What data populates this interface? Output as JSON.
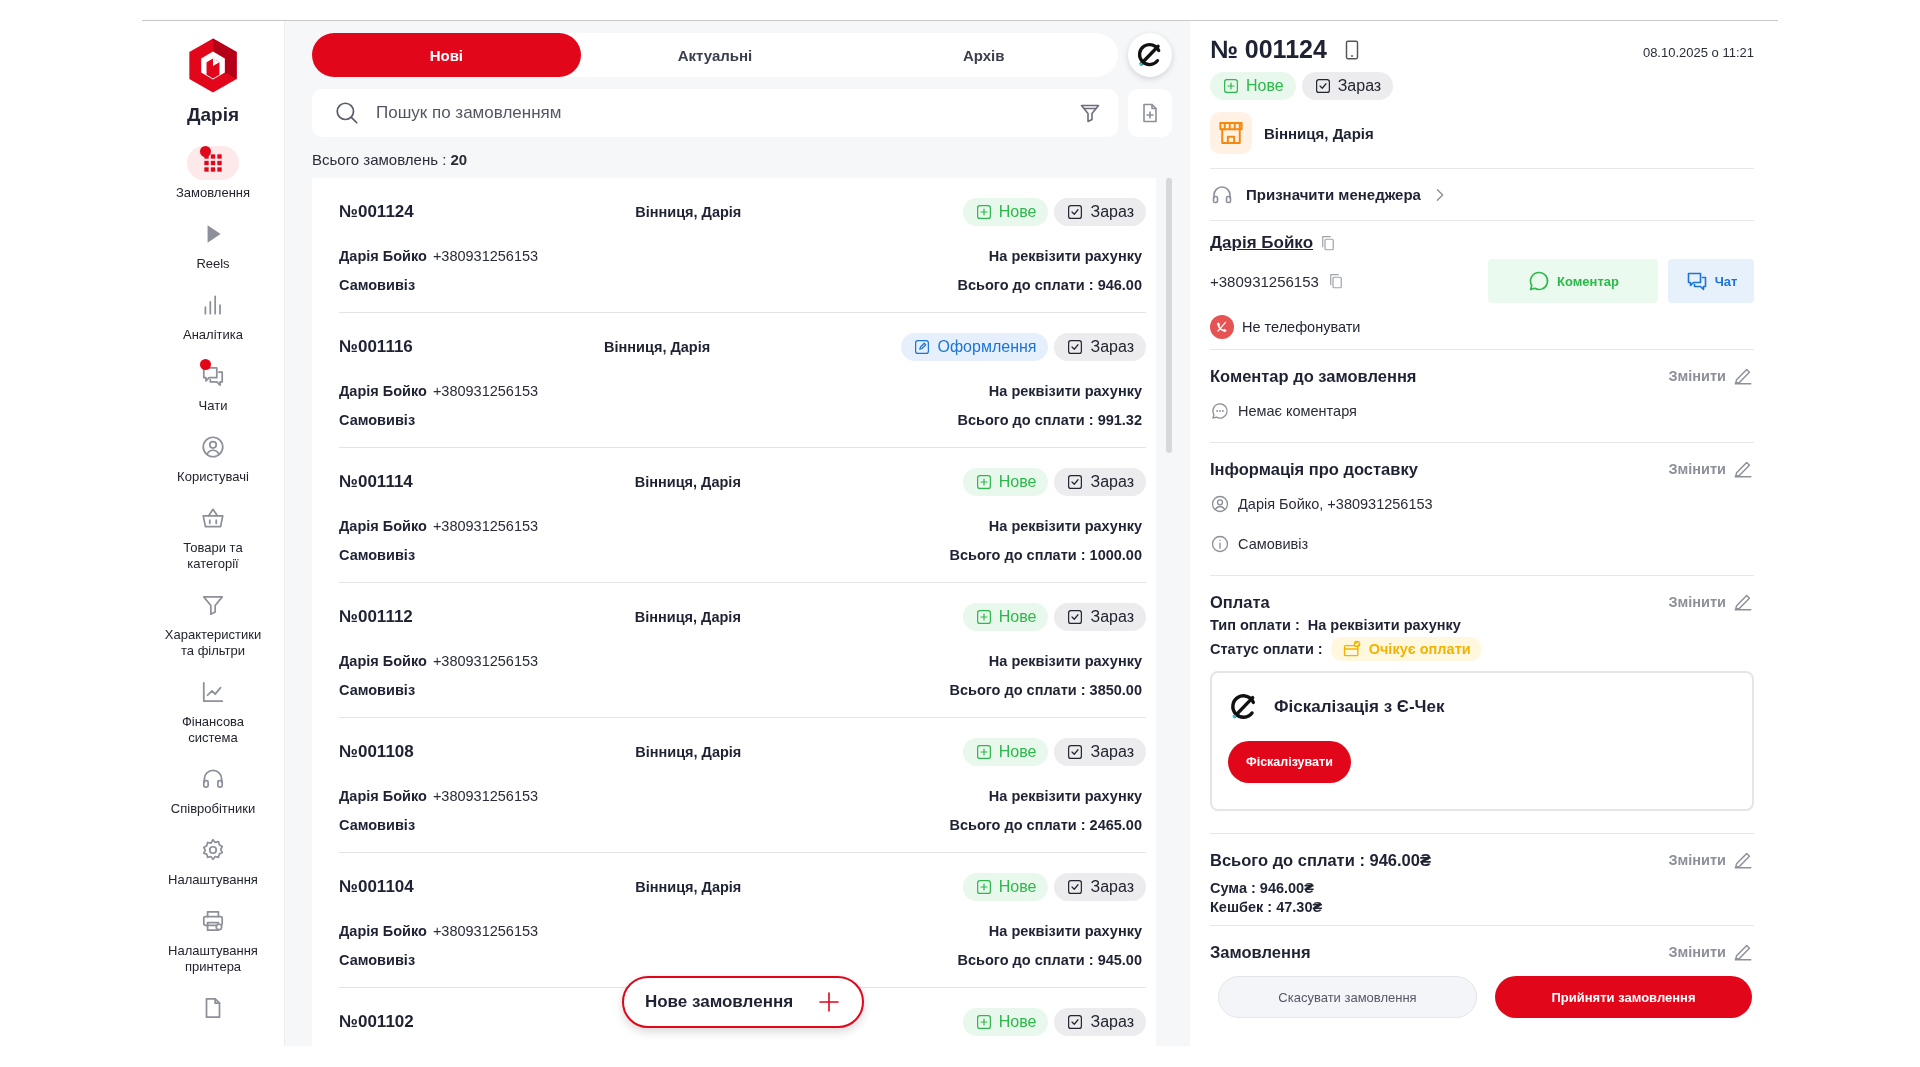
{
  "sidebar": {
    "user_name": "Дарія",
    "items": [
      {
        "label": "Замовлення",
        "selected": true,
        "notification": true
      },
      {
        "label": "Reels",
        "selected": false,
        "notification": false
      },
      {
        "label": "Аналітика",
        "selected": false,
        "notification": false
      },
      {
        "label": "Чати",
        "selected": false,
        "notification": true
      },
      {
        "label": "Користувачі",
        "selected": false,
        "notification": false
      },
      {
        "label": "Товари та категорії",
        "selected": false,
        "notification": false
      },
      {
        "label": "Характеристики та фільтри",
        "selected": false,
        "notification": false
      },
      {
        "label": "Фінансова система",
        "selected": false,
        "notification": false
      },
      {
        "label": "Співробітники",
        "selected": false,
        "notification": false
      },
      {
        "label": "Налаштування",
        "selected": false,
        "notification": false
      },
      {
        "label": "Налаштування принтера",
        "selected": false,
        "notification": false
      },
      {
        "selected": false,
        "notification": false
      }
    ]
  },
  "tabs": [
    {
      "label": "Нові",
      "selected": true
    },
    {
      "label": "Актуальні",
      "selected": false
    },
    {
      "label": "Архів",
      "selected": false
    }
  ],
  "search": {
    "placeholder": "Пошук по замовленням"
  },
  "orders_total": "Всього замовлень : **20**",
  "orders": [
    {
      "number": "№001124",
      "city": "Вінниця, Дарія",
      "badges": [
        {
          "kind": "new",
          "label": "Нове"
        },
        {
          "kind": "timing",
          "label": "Зараз"
        }
      ],
      "customer": "Дарія Бойко",
      "phone": "+380931256153",
      "payment": "На реквізити рахунку",
      "delivery": "Самовивіз",
      "total": "Всього до сплати : 946.00"
    },
    {
      "number": "№001116",
      "city": "Вінниця, Дарія",
      "badges": [
        {
          "kind": "processing",
          "label": "Оформлення"
        },
        {
          "kind": "timing",
          "label": "Зараз"
        }
      ],
      "customer": "Дарія Бойко",
      "phone": "+380931256153",
      "payment": "На реквізити рахунку",
      "delivery": "Самовивіз",
      "total": "Всього до сплати : 991.32"
    },
    {
      "number": "№001114",
      "city": "Вінниця, Дарія",
      "badges": [
        {
          "kind": "new",
          "label": "Нове"
        },
        {
          "kind": "timing",
          "label": "Зараз"
        }
      ],
      "customer": "Дарія Бойко",
      "phone": "+380931256153",
      "payment": "На реквізити рахунку",
      "delivery": "Самовивіз",
      "total": "Всього до сплати : 1000.00"
    },
    {
      "number": "№001112",
      "city": "Вінниця, Дарія",
      "badges": [
        {
          "kind": "new",
          "label": "Нове"
        },
        {
          "kind": "timing",
          "label": "Зараз"
        }
      ],
      "customer": "Дарія Бойко",
      "phone": "+380931256153",
      "payment": "На реквізити рахунку",
      "delivery": "Самовивіз",
      "total": "Всього до сплати : 3850.00"
    },
    {
      "number": "№001108",
      "city": "Вінниця, Дарія",
      "badges": [
        {
          "kind": "new",
          "label": "Нове"
        },
        {
          "kind": "timing",
          "label": "Зараз"
        }
      ],
      "customer": "Дарія Бойко",
      "phone": "+380931256153",
      "payment": "На реквізити рахунку",
      "delivery": "Самовивіз",
      "total": "Всього до сплати : 2465.00"
    },
    {
      "number": "№001104",
      "city": "Вінниця, Дарія",
      "badges": [
        {
          "kind": "new",
          "label": "Нове"
        },
        {
          "kind": "timing",
          "label": "Зараз"
        }
      ],
      "customer": "Дарія Бойко",
      "phone": "+380931256153",
      "payment": "На реквізити рахунку",
      "delivery": "Самовивіз",
      "total": "Всього до сплати : 945.00"
    },
    {
      "number": "№001102",
      "badges": [
        {
          "kind": "new",
          "label": "Нове"
        },
        {
          "kind": "timing",
          "label": "Зараз"
        }
      ]
    }
  ],
  "new_order_button": "Нове замовлення",
  "detail": {
    "number": "№ 001124",
    "date": "08.10.2025 о 11:21",
    "badges": [
      {
        "kind": "new",
        "label": "Нове"
      },
      {
        "kind": "timing",
        "label": "Зараз"
      }
    ],
    "store": "Вінниця, Дарія",
    "manager_link": "Призначити менеджера",
    "customer_name": "Дарія Бойко",
    "customer_phone": "+380931256153",
    "comment_button": "Коментар",
    "chat_button": "Чат",
    "no_call": "Не телефонувати",
    "comment": {
      "title": "Коментар до замовлення",
      "edit": "Змінити",
      "text": "Немає коментаря"
    },
    "delivery": {
      "title": "Інформація про доставку",
      "edit": "Змінити",
      "recipient": "Дарія Бойко, +380931256153",
      "method": "Самовивіз"
    },
    "payment": {
      "title": "Оплата",
      "edit": "Змінити",
      "type_label": "Тип оплати :",
      "type": "На реквізити рахунку",
      "status_label": "Статус оплати :",
      "status": "Очікує оплати"
    },
    "fiscal": {
      "title": "Фіскалізація з Є-Чек",
      "button": "Фіскалізувати"
    },
    "totals": {
      "title": "Всього до сплати : 946.00₴",
      "edit": "Змінити",
      "lines": [
        "Сума : 946.00₴",
        "Кешбек : 47.30₴"
      ]
    },
    "items": {
      "title": "Замовлення",
      "edit": "Змінити"
    },
    "cancel_button": "Скасувати замовлення",
    "accept_button": "Прийняти замовлення"
  }
}
